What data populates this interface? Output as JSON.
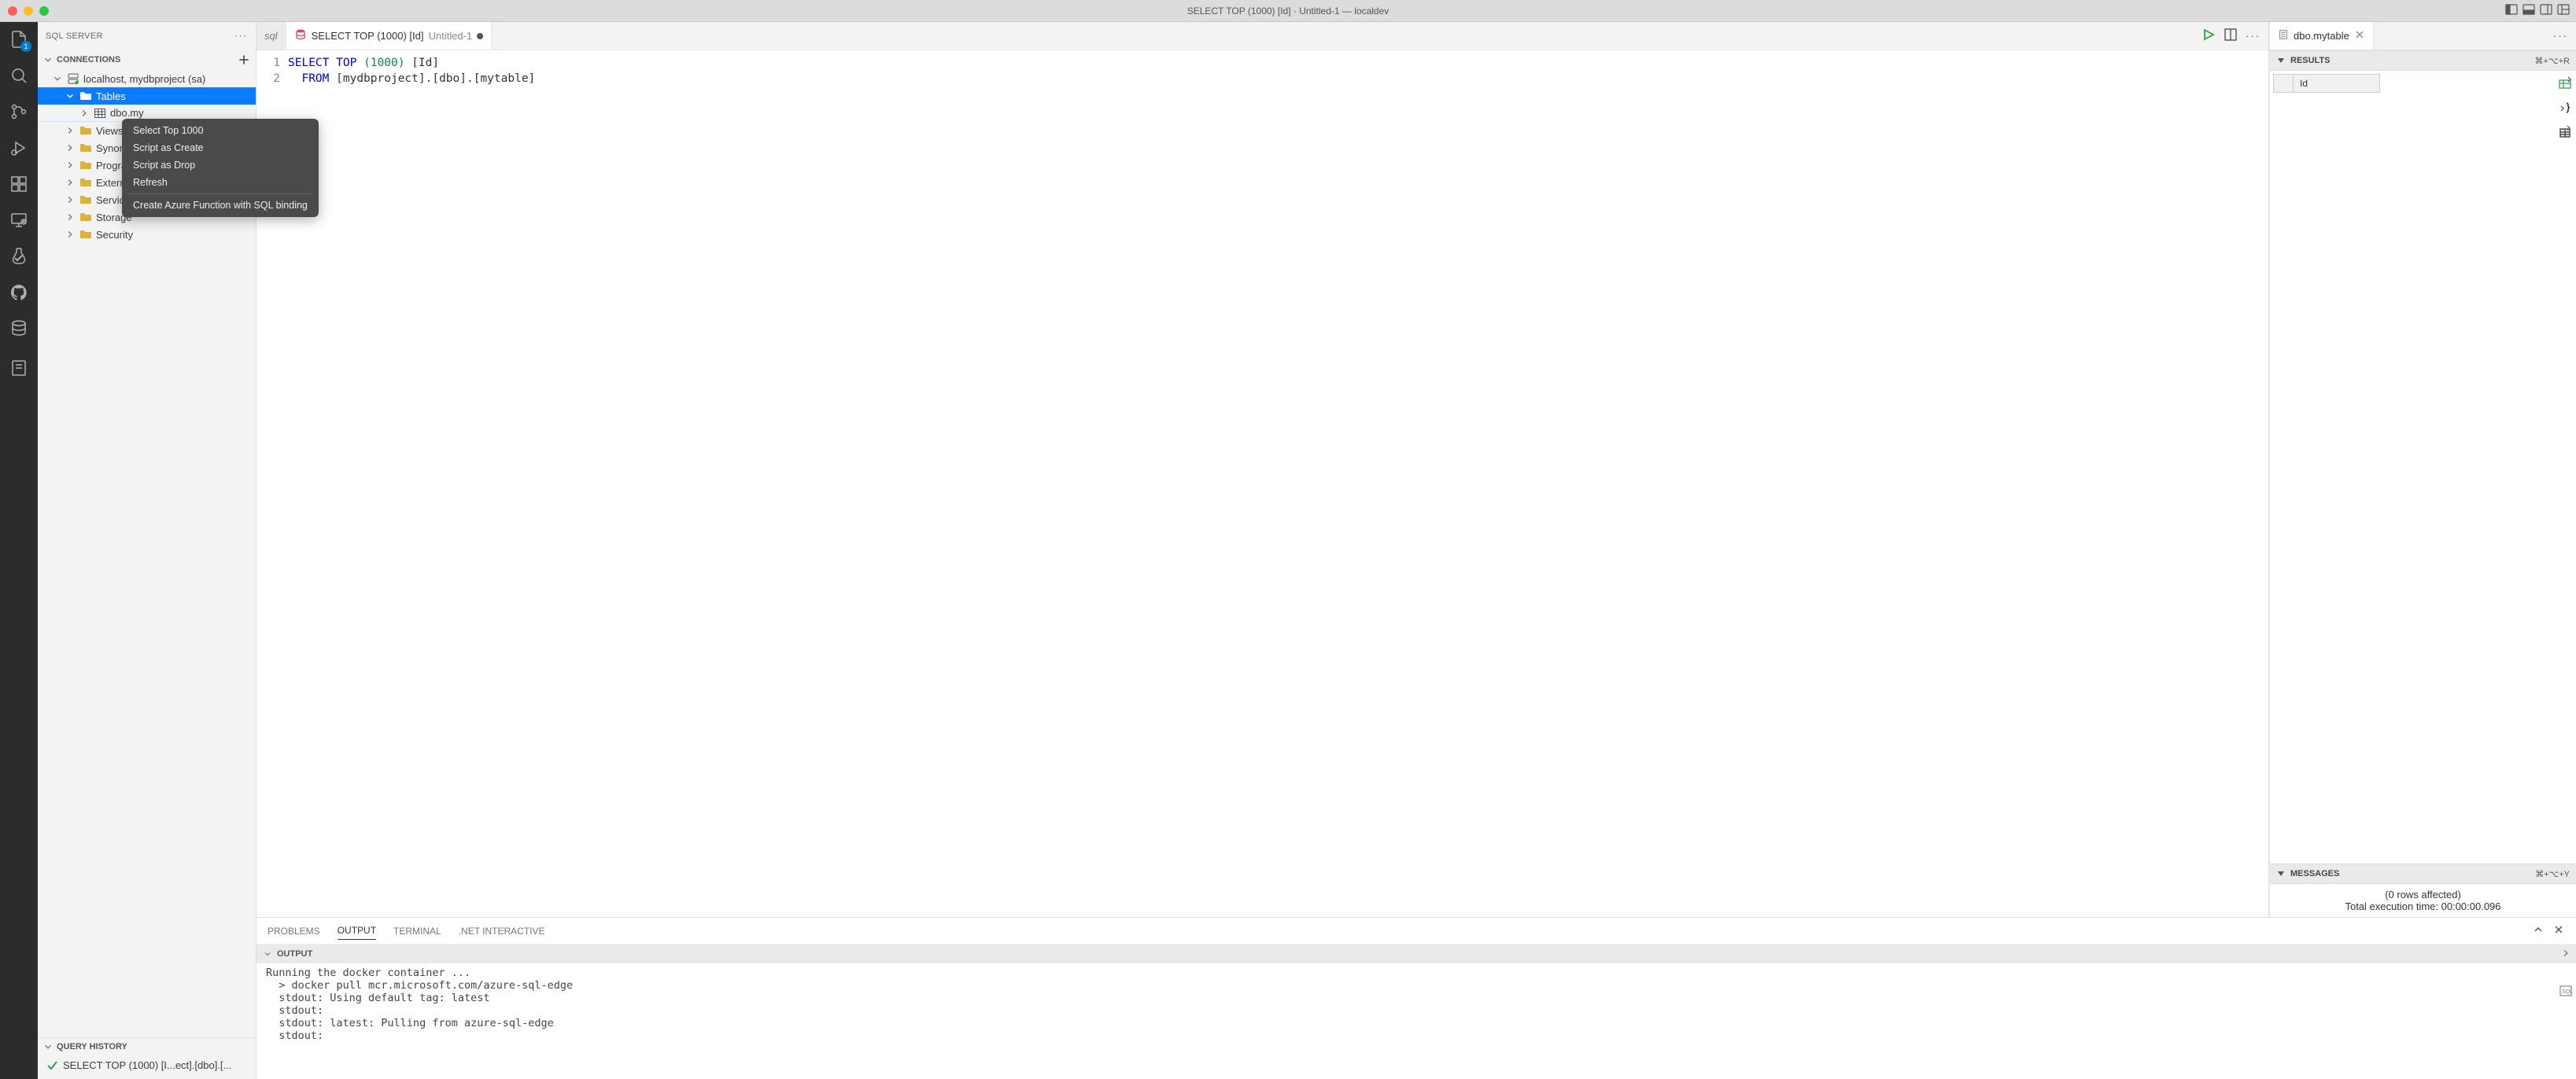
{
  "window": {
    "title": "SELECT TOP (1000) [Id] · Untitled-1 — localdev"
  },
  "activitybar": {
    "explorer_badge": "1"
  },
  "sidebar": {
    "title": "SQL SERVER",
    "sections": {
      "connections_label": "CONNECTIONS",
      "query_history_label": "QUERY HISTORY"
    },
    "connection": {
      "label": "localhost, mydbproject (sa)"
    },
    "tree": {
      "tables": "Tables",
      "table_item": "dbo.my",
      "views": "Views",
      "synonyms": "Synony",
      "programmability": "Progra",
      "external": "External Resources",
      "service_broker": "Service Broker",
      "storage": "Storage",
      "security": "Security"
    },
    "history_item": "SELECT TOP (1000) [I...ect].[dbo].[..."
  },
  "context_menu": {
    "item1": "Select Top 1000",
    "item2": "Script as Create",
    "item3": "Script as Drop",
    "item4": "Refresh",
    "item5": "Create Azure Function with SQL binding"
  },
  "tabs": {
    "prev": "sql",
    "active_title": "SELECT TOP (1000) [Id]",
    "active_sub": "Untitled-1",
    "results_tab": "dbo.mytable"
  },
  "code": {
    "line1_kw1": "SELECT",
    "line1_kw2": "TOP",
    "line1_paren_open": "(",
    "line1_num": "1000",
    "line1_paren_close": ")",
    "line1_id": "[Id]",
    "line2_kw": "FROM",
    "line2_rest": "[mydbproject].[dbo].[mytable]",
    "ln1": "1",
    "ln2": "2"
  },
  "results": {
    "header": "RESULTS",
    "shortcut": "⌘+⌥+R",
    "col1": "Id",
    "messages_header": "MESSAGES",
    "messages_shortcut": "⌘+⌥+Y",
    "msg_line1": "(0 rows affected)",
    "msg_line2": "Total execution time: 00:00:00.096"
  },
  "bottom_panel": {
    "problems": "PROBLEMS",
    "output": "OUTPUT",
    "terminal": "TERMINAL",
    "dotnet": ".NET INTERACTIVE",
    "output_header": "OUTPUT",
    "lines": [
      "Running the docker container ...",
      "  > docker pull mcr.microsoft.com/azure-sql-edge",
      "  stdout: Using default tag: latest",
      "  stdout:",
      "  stdout: latest: Pulling from azure-sql-edge",
      "  stdout:"
    ]
  }
}
